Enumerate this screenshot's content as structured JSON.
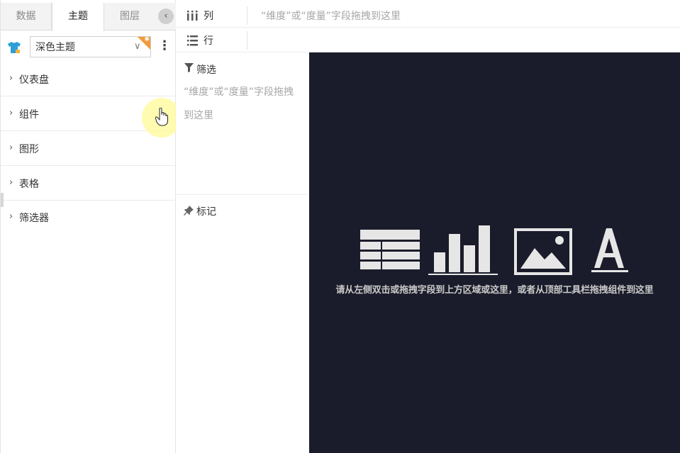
{
  "left_panel": {
    "tabs": [
      {
        "label": "数据"
      },
      {
        "label": "主题"
      },
      {
        "label": "图层"
      }
    ],
    "collapse_icon": "chevron-left-icon",
    "theme_select": {
      "value": "深色主题"
    },
    "categories": [
      {
        "label": "仪表盘"
      },
      {
        "label": "组件"
      },
      {
        "label": "图形"
      },
      {
        "label": "表格"
      },
      {
        "label": "筛选器"
      }
    ]
  },
  "shelves": {
    "columns": {
      "label": "列",
      "hint": "“维度”或“度量”字段拖拽到这里"
    },
    "rows": {
      "label": "行"
    }
  },
  "filter_panel": {
    "title": "筛选",
    "hint": "“维度”或“度量”字段拖拽到这里"
  },
  "marks_panel": {
    "title": "标记"
  },
  "canvas": {
    "background": "#1b1c2b",
    "message": "请从左侧双击或拖拽字段到上方区域或这里，或者从顶部工具栏拖拽组件到这里",
    "icons": [
      "table-icon",
      "bar-chart-icon",
      "image-icon",
      "text-icon"
    ]
  },
  "colors": {
    "accent_orange": "#f29a3b",
    "shirt_blue": "#2b9fd8",
    "cursor_halo": "#fffa96"
  }
}
